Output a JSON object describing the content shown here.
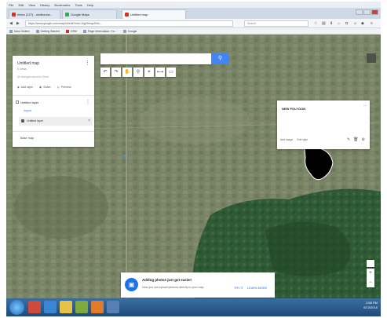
{
  "browser": {
    "menu": [
      "File",
      "Edit",
      "View",
      "History",
      "Bookmarks",
      "Tools",
      "Help"
    ],
    "tabs": [
      {
        "label": "Inbox (127) - ondiba.kw...",
        "color": "#d93025"
      },
      {
        "label": "Google Maps",
        "color": "#d93025"
      },
      {
        "label": "Untitled map",
        "color": "#d93025"
      }
    ],
    "url": "https://www.google.com/maps/d/edit?mid=1lqjHbnqxJNm...",
    "search_placeholder": "Search",
    "bookmarks": [
      "Most Visited",
      "Getting Started",
      "OSM",
      "Page Information: Co...",
      "Google"
    ]
  },
  "panel": {
    "title": "Untitled map",
    "subtitle": "0 views",
    "saved": "All changes saved in Drive",
    "actions": [
      "Add layer",
      "Share",
      "Preview"
    ],
    "layer_title": "Untitled layer",
    "import_link": "Import",
    "layer_item": "Untitled layer",
    "base_map": "Base map"
  },
  "map_search": {
    "placeholder": ""
  },
  "tools": [
    "↶",
    "↷",
    "✋",
    "⚲",
    "⌖",
    "⟷",
    "▭"
  ],
  "info_card": {
    "title": "NEW POLYGON",
    "footer": [
      "Add image",
      "Edit style"
    ],
    "tools": [
      "✎",
      "🗑",
      "⚙"
    ]
  },
  "toast": {
    "title": "Adding photos just got easier!",
    "text": "Now you can upload pictures directly to your map",
    "try_label": "TRY IT",
    "learn_label": "LEARN MORE"
  },
  "tray": {
    "time": "2:58 PM",
    "date": "6/13/2016"
  }
}
